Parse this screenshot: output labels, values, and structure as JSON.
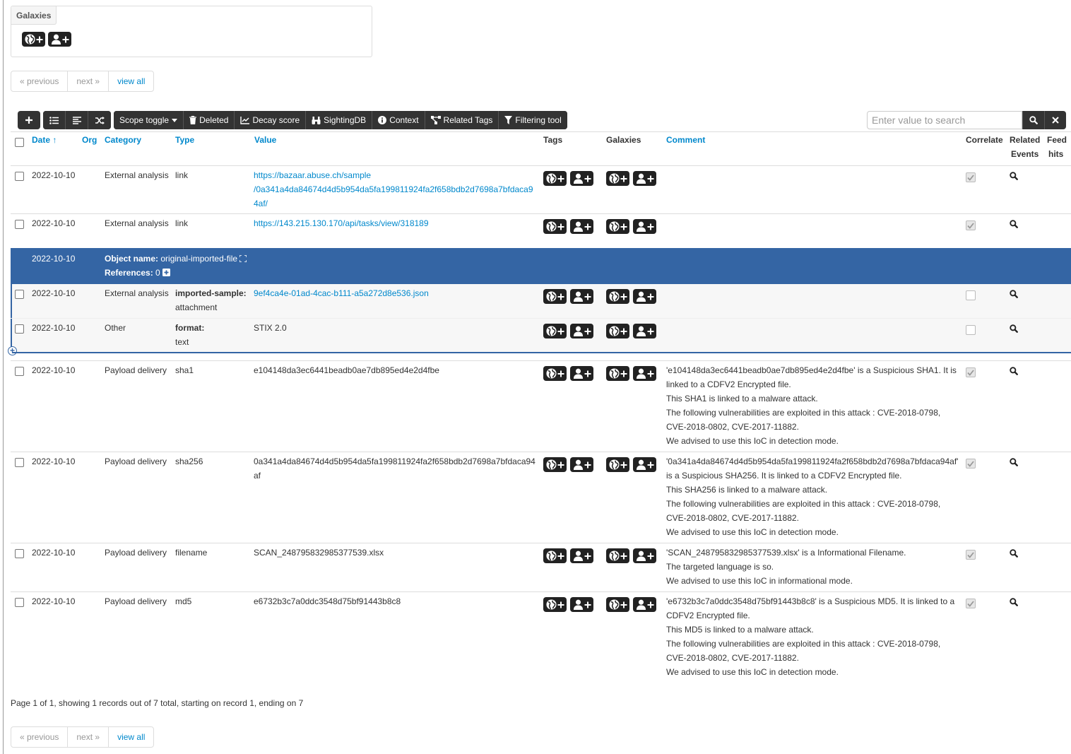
{
  "galaxies_box": {
    "title": "Galaxies"
  },
  "pager": {
    "previous": "« previous",
    "next": "next »",
    "view_all": "view all"
  },
  "toolbar": {
    "scope_toggle": "Scope toggle",
    "deleted": "Deleted",
    "decay_score": "Decay score",
    "sightingdb": "SightingDB",
    "context": "Context",
    "related_tags": "Related Tags",
    "filtering_tool": "Filtering tool",
    "search_placeholder": "Enter value to search"
  },
  "headers": {
    "date": "Date ↑",
    "org": "Org",
    "category": "Category",
    "type": "Type",
    "value": "Value",
    "tags": "Tags",
    "galaxies": "Galaxies",
    "comment": "Comment",
    "correlate": "Correlate",
    "related_events_1": "Related",
    "related_events_2": "Events",
    "feed_hits_1": "Feed",
    "feed_hits_2": "hits"
  },
  "rows": [
    {
      "date": "2022-10-10",
      "category": "External analysis",
      "type": "link",
      "value_lines": [
        "https://bazaar.abuse.ch/sample",
        "/0a341a4da84674d4d5b954da5fa199811924fa2f658bdb2d7698a7bfdaca9",
        "4af/"
      ],
      "comment_lines": []
    },
    {
      "date": "2022-10-10",
      "category": "External analysis",
      "type": "link",
      "value_lines": [
        "https://143.215.130.170/api/tasks/view/318189"
      ],
      "comment_lines": []
    }
  ],
  "object": {
    "date": "2022-10-10",
    "name_label": "Object name:",
    "name_value": "original-imported-file",
    "references_label": "References:",
    "references_value": "0",
    "attributes": [
      {
        "date": "2022-10-10",
        "category": "External analysis",
        "relation": "imported-sample:",
        "type": "attachment",
        "value": "9ef4ca4e-01ad-4cac-b111-a5a272d8e536.json"
      },
      {
        "date": "2022-10-10",
        "category": "Other",
        "relation": "format:",
        "type": "text",
        "value": "STIX 2.0"
      }
    ]
  },
  "rows2": [
    {
      "date": "2022-10-10",
      "category": "Payload delivery",
      "type": "sha1",
      "value_lines": [
        "e104148da3ec6441beadb0ae7db895ed4e2d4fbe"
      ],
      "comment_lines": [
        "'e104148da3ec6441beadb0ae7db895ed4e2d4fbe' is a Suspicious SHA1. It is",
        "linked to a CDFV2 Encrypted file.",
        "This SHA1 is linked to a malware attack.",
        "The following vulnerabilities are exploited in this attack : CVE-2018-0798,",
        "CVE-2018-0802, CVE-2017-11882.",
        "We advised to use this IoC in detection mode."
      ]
    },
    {
      "date": "2022-10-10",
      "category": "Payload delivery",
      "type": "sha256",
      "value_lines": [
        "0a341a4da84674d4d5b954da5fa199811924fa2f658bdb2d7698a7bfdaca94",
        "af"
      ],
      "comment_lines": [
        "'0a341a4da84674d4d5b954da5fa199811924fa2f658bdb2d7698a7bfdaca94af'",
        "is a Suspicious SHA256. It is linked to a CDFV2 Encrypted file.",
        "This SHA256 is linked to a malware attack.",
        "The following vulnerabilities are exploited in this attack : CVE-2018-0798,",
        "CVE-2018-0802, CVE-2017-11882.",
        "We advised to use this IoC in detection mode."
      ]
    },
    {
      "date": "2022-10-10",
      "category": "Payload delivery",
      "type": "filename",
      "value_lines": [
        "SCAN_248795832985377539.xlsx"
      ],
      "comment_lines": [
        "'SCAN_248795832985377539.xlsx' is a Informational Filename.",
        "The targeted language is so.",
        "We advised to use this IoC in informational mode."
      ]
    },
    {
      "date": "2022-10-10",
      "category": "Payload delivery",
      "type": "md5",
      "value_lines": [
        "e6732b3c7a0ddc3548d75bf91443b8c8"
      ],
      "comment_lines": [
        "'e6732b3c7a0ddc3548d75bf91443b8c8' is a Suspicious MD5. It is linked to a",
        "CDFV2 Encrypted file.",
        "This MD5 is linked to a malware attack.",
        "The following vulnerabilities are exploited in this attack : CVE-2018-0798,",
        "CVE-2018-0802, CVE-2017-11882.",
        "We advised to use this IoC in detection mode."
      ]
    }
  ],
  "footer": {
    "summary": "Page 1 of 1, showing 1 records out of 7 total, starting on record 1, ending on 7"
  },
  "colors": {
    "object_header": "#3465a4",
    "link": "#0088cc",
    "toolbar": "#333333"
  }
}
